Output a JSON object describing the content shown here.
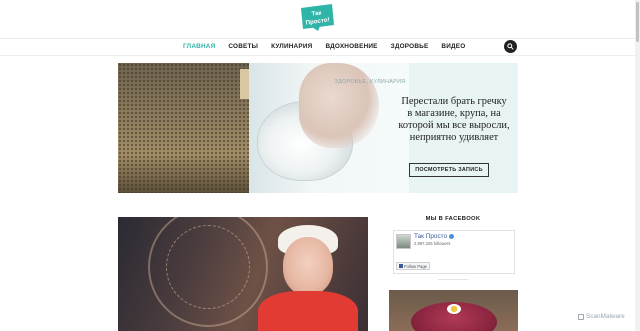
{
  "logo": {
    "text": "Так Просто!",
    "bg_color": "#2fb4a8",
    "text_color": "#ffffff"
  },
  "nav": {
    "items": [
      {
        "label": "ГЛАВНАЯ",
        "active": true
      },
      {
        "label": "СОВЕТЫ",
        "active": false
      },
      {
        "label": "КУЛИНАРИЯ",
        "active": false
      },
      {
        "label": "ВДОХНОВЕНИЕ",
        "active": false
      },
      {
        "label": "ЗДОРОВЬЕ",
        "active": false
      },
      {
        "label": "ВИДЕО",
        "active": false
      }
    ],
    "search_icon": "search-icon",
    "active_color": "#2fb4a8"
  },
  "hero": {
    "category": "ЗДОРОВЬЕ, КУЛИНАРИЯ",
    "title": "Перестали брать гречку в магазине, крупа, на которой мы все выросли, неприятно удивляет",
    "button_label": "ПОСМОТРЕТЬ ЗАПИСЬ",
    "bg_color": "#e8f4f4"
  },
  "sidebar": {
    "title": "МЫ В FACEBOOK",
    "fb": {
      "page_name": "Так Просто",
      "followers": "2,997,326 followers",
      "follow_label": "Follow Page"
    }
  },
  "watermark": {
    "text": "ScanMalware"
  }
}
